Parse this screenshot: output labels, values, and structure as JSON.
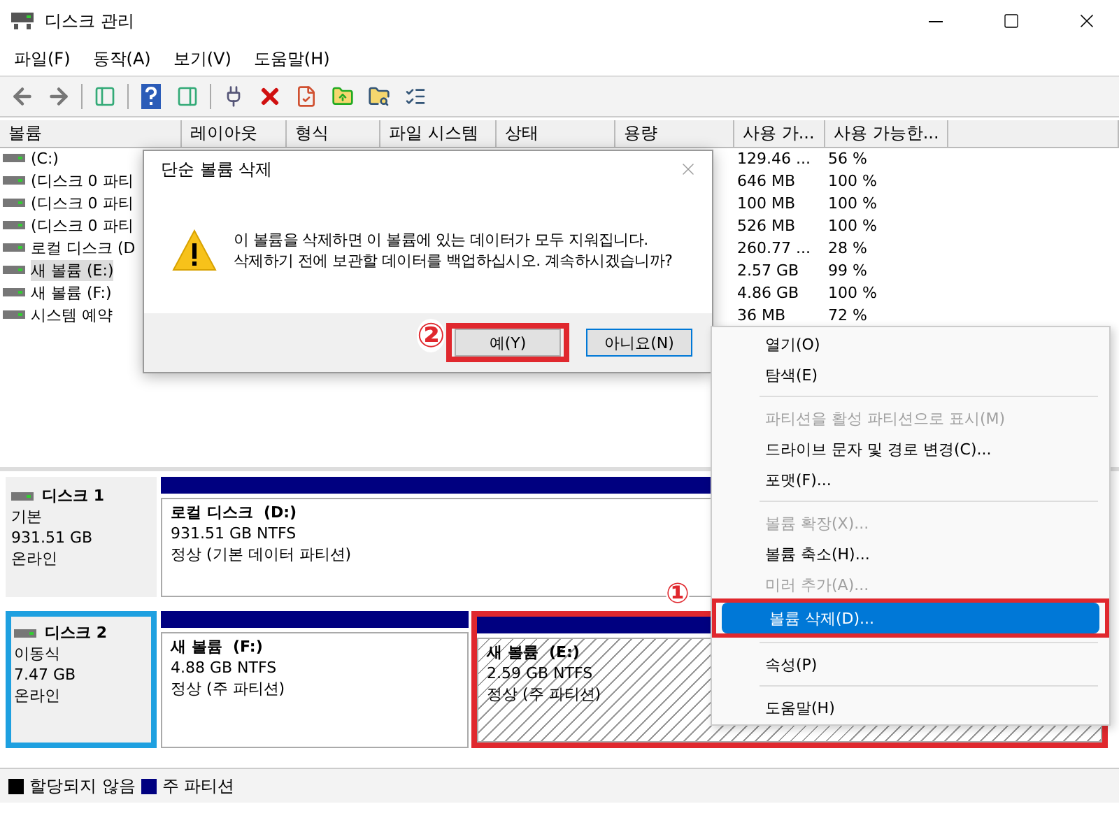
{
  "window": {
    "title": "디스크 관리"
  },
  "menu": [
    "파일(F)",
    "동작(A)",
    "보기(V)",
    "도움말(H)"
  ],
  "volumes": {
    "columns": [
      "볼륨",
      "레이아웃",
      "형식",
      "파일 시스템",
      "상태",
      "용량",
      "사용 가...",
      "사용 가능한..."
    ],
    "rows": [
      {
        "name": "(C:)",
        "free": "129.46 ...",
        "percent": "56 %",
        "selected": false
      },
      {
        "name": "(디스크 0 파티",
        "free": "646 MB",
        "percent": "100 %",
        "selected": false
      },
      {
        "name": "(디스크 0 파티",
        "free": "100 MB",
        "percent": "100 %",
        "selected": false
      },
      {
        "name": "(디스크 0 파티",
        "free": "526 MB",
        "percent": "100 %",
        "selected": false
      },
      {
        "name": "로컬 디스크 (D",
        "free": "260.77 ...",
        "percent": "28 %",
        "selected": false
      },
      {
        "name": "새 볼륨 (E:)",
        "free": "2.57 GB",
        "percent": "99 %",
        "selected": true
      },
      {
        "name": "새 볼륨 (F:)",
        "free": "4.86 GB",
        "percent": "100 %",
        "selected": false
      },
      {
        "name": "시스템 예약",
        "free": "36 MB",
        "percent": "72 %",
        "selected": false
      }
    ]
  },
  "disks": [
    {
      "name": "디스크 1",
      "type": "기본",
      "size": "931.51 GB",
      "status": "온라인",
      "highlighted": false,
      "partitions": [
        {
          "name": "로컬 디스크  (D:)",
          "size": "931.51 GB NTFS",
          "status": "정상 (기본 데이터 파티션)",
          "selected": false
        }
      ]
    },
    {
      "name": "디스크 2",
      "type": "이동식",
      "size": "7.47 GB",
      "status": "온라인",
      "highlighted": true,
      "partitions": [
        {
          "name": "새 볼륨  (F:)",
          "size": "4.88 GB NTFS",
          "status": "정상 (주 파티션)",
          "selected": false
        },
        {
          "name": "새 볼륨  (E:)",
          "size": "2.59 GB NTFS",
          "status": "정상 (주 파티션)",
          "selected": true,
          "highlighted": true
        }
      ]
    }
  ],
  "legend": [
    {
      "label": "할당되지 않음",
      "color": "#000000"
    },
    {
      "label": "주 파티션",
      "color": "#000080"
    }
  ],
  "dialog": {
    "title": "단순 볼륨 삭제",
    "lines": [
      "이 볼륨을 삭제하면 이 볼륨에 있는 데이터가 모두 지워집니다.",
      "삭제하기 전에 보관할 데이터를 백업하십시오. 계속하시겠습니까?"
    ],
    "buttons": [
      {
        "label": "예(Y)",
        "highlighted": true
      },
      {
        "label": "아니요(N)"
      }
    ]
  },
  "context_menu": [
    {
      "kind": "item",
      "label": "열기(O)",
      "disabled": false,
      "selected": false
    },
    {
      "kind": "item",
      "label": "탐색(E)",
      "disabled": false,
      "selected": false
    },
    {
      "kind": "separator"
    },
    {
      "kind": "item",
      "label": "파티션을 활성 파티션으로 표시(M)",
      "disabled": true,
      "selected": false
    },
    {
      "kind": "item",
      "label": "드라이브 문자 및 경로 변경(C)...",
      "disabled": false,
      "selected": false
    },
    {
      "kind": "item",
      "label": "포맷(F)...",
      "disabled": false,
      "selected": false
    },
    {
      "kind": "separator"
    },
    {
      "kind": "item",
      "label": "볼륨 확장(X)...",
      "disabled": true,
      "selected": false
    },
    {
      "kind": "item",
      "label": "볼륨 축소(H)...",
      "disabled": false,
      "selected": false
    },
    {
      "kind": "item",
      "label": "미러 추가(A)...",
      "disabled": true,
      "selected": false
    },
    {
      "kind": "item",
      "label": "볼륨 삭제(D)...",
      "disabled": false,
      "selected": true,
      "highlighted": true
    },
    {
      "kind": "separator"
    },
    {
      "kind": "item",
      "label": "속성(P)",
      "disabled": false,
      "selected": false
    },
    {
      "kind": "separator"
    },
    {
      "kind": "item",
      "label": "도움말(H)",
      "disabled": false,
      "selected": false
    }
  ],
  "annotations": [
    {
      "label": "①"
    },
    {
      "label": "②"
    }
  ]
}
